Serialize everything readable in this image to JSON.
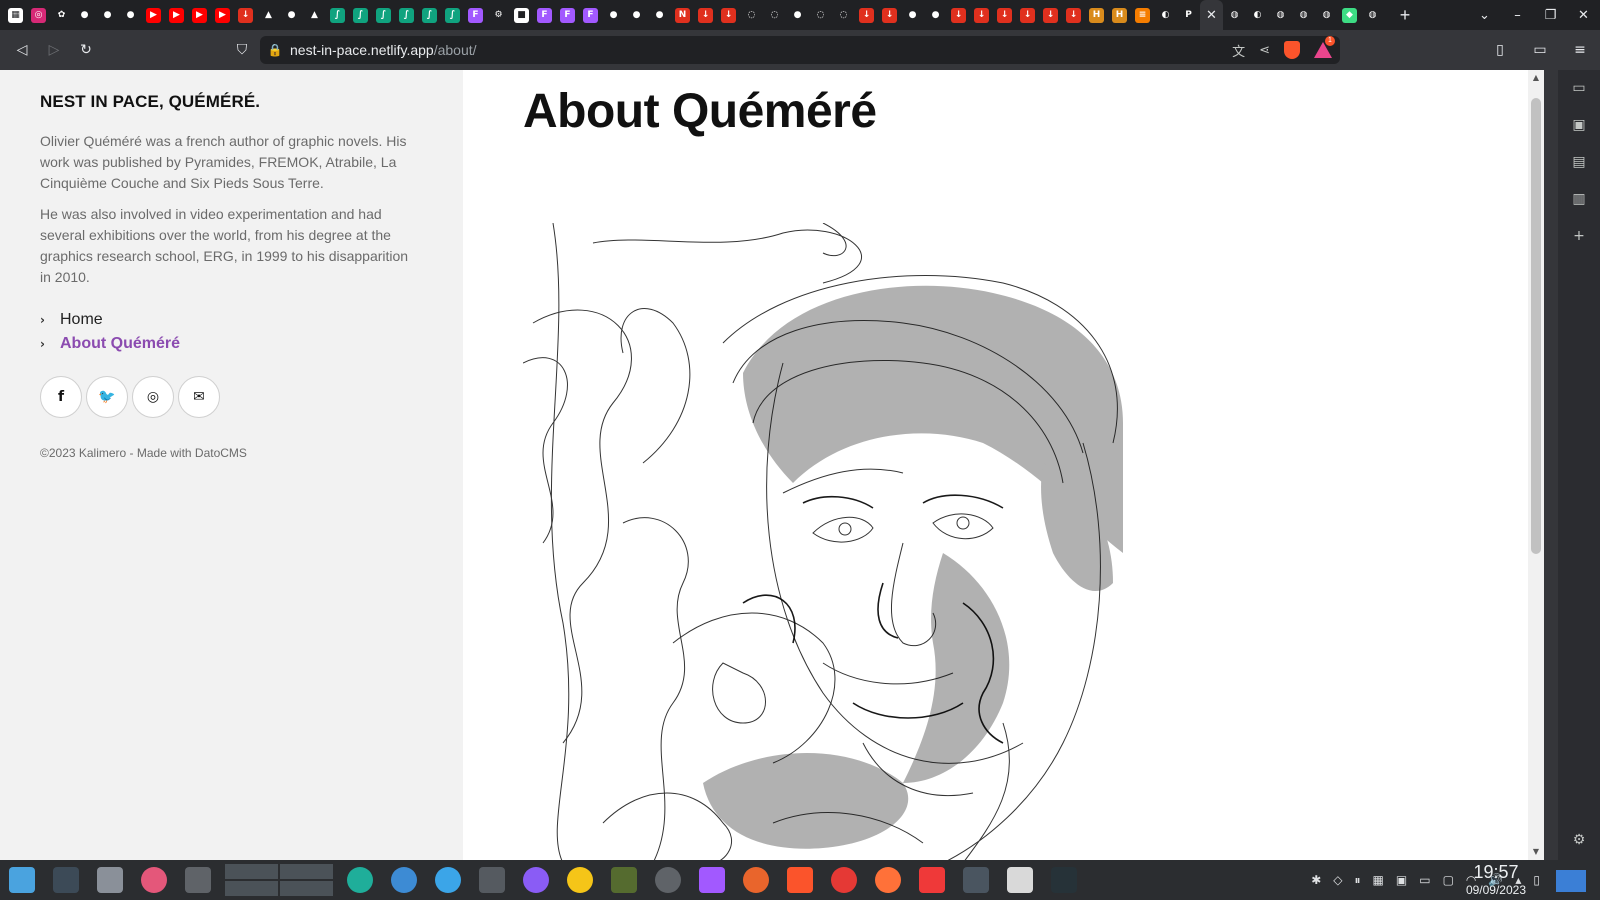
{
  "browser": {
    "tabs": [
      {
        "icon": "grid-icon",
        "color": "#ffffff",
        "glyph": "▦"
      },
      {
        "icon": "instagram-icon",
        "color": "#d62976",
        "glyph": "◎"
      },
      {
        "icon": "game-icon",
        "color": "#202124",
        "glyph": "✿"
      },
      {
        "icon": "github-icon",
        "color": "#202124",
        "glyph": "●"
      },
      {
        "icon": "github-icon",
        "color": "#202124",
        "glyph": "●"
      },
      {
        "icon": "github-icon",
        "color": "#202124",
        "glyph": "●"
      },
      {
        "icon": "youtube-icon",
        "color": "#ff0000",
        "glyph": "▶"
      },
      {
        "icon": "youtube-icon",
        "color": "#ff0000",
        "glyph": "▶"
      },
      {
        "icon": "youtube-icon",
        "color": "#ff0000",
        "glyph": "▶"
      },
      {
        "icon": "youtube-icon",
        "color": "#ff0000",
        "glyph": "▶"
      },
      {
        "icon": "download-icon",
        "color": "#e0301e",
        "glyph": "↓"
      },
      {
        "icon": "drive-icon",
        "color": "#202124",
        "glyph": "▲"
      },
      {
        "icon": "github-icon",
        "color": "#202124",
        "glyph": "●"
      },
      {
        "icon": "arc-icon",
        "color": "#202124",
        "glyph": "▲"
      },
      {
        "icon": "lean-icon",
        "color": "#10a37f",
        "glyph": "∫"
      },
      {
        "icon": "lean-icon",
        "color": "#10a37f",
        "glyph": "∫"
      },
      {
        "icon": "lean-icon",
        "color": "#10a37f",
        "glyph": "∫"
      },
      {
        "icon": "lean-icon",
        "color": "#10a37f",
        "glyph": "∫"
      },
      {
        "icon": "lean-icon",
        "color": "#10a37f",
        "glyph": "∫"
      },
      {
        "icon": "lean-icon",
        "color": "#10a37f",
        "glyph": "∫"
      },
      {
        "icon": "figma-icon",
        "color": "#a259ff",
        "glyph": "F"
      },
      {
        "icon": "settings-icon",
        "color": "#202124",
        "glyph": "⚙"
      },
      {
        "icon": "cube-icon",
        "color": "#ffffff",
        "glyph": "■"
      },
      {
        "icon": "figma-icon",
        "color": "#a259ff",
        "glyph": "F"
      },
      {
        "icon": "figma-icon",
        "color": "#a259ff",
        "glyph": "F"
      },
      {
        "icon": "figma-icon",
        "color": "#a259ff",
        "glyph": "F"
      },
      {
        "icon": "github-icon",
        "color": "#202124",
        "glyph": "●"
      },
      {
        "icon": "github-icon",
        "color": "#202124",
        "glyph": "●"
      },
      {
        "icon": "github-icon",
        "color": "#202124",
        "glyph": "●"
      },
      {
        "icon": "notion-icon",
        "color": "#e0301e",
        "glyph": "N"
      },
      {
        "icon": "download-icon",
        "color": "#e0301e",
        "glyph": "↓"
      },
      {
        "icon": "download-icon",
        "color": "#e0301e",
        "glyph": "↓"
      },
      {
        "icon": "ring-icon",
        "color": "#202124",
        "glyph": "◌"
      },
      {
        "icon": "ring-icon",
        "color": "#202124",
        "glyph": "◌"
      },
      {
        "icon": "github-icon",
        "color": "#202124",
        "glyph": "●"
      },
      {
        "icon": "ring-icon",
        "color": "#202124",
        "glyph": "◌"
      },
      {
        "icon": "ring-icon",
        "color": "#202124",
        "glyph": "◌"
      },
      {
        "icon": "download-icon",
        "color": "#e0301e",
        "glyph": "↓"
      },
      {
        "icon": "download-icon",
        "color": "#e0301e",
        "glyph": "↓"
      },
      {
        "icon": "github-icon",
        "color": "#202124",
        "glyph": "●"
      },
      {
        "icon": "github-icon",
        "color": "#202124",
        "glyph": "●"
      },
      {
        "icon": "download-icon",
        "color": "#e0301e",
        "glyph": "↓"
      },
      {
        "icon": "download-icon",
        "color": "#e0301e",
        "glyph": "↓"
      },
      {
        "icon": "download-icon",
        "color": "#e0301e",
        "glyph": "↓"
      },
      {
        "icon": "download-icon",
        "color": "#e0301e",
        "glyph": "↓"
      },
      {
        "icon": "download-icon",
        "color": "#e0301e",
        "glyph": "↓"
      },
      {
        "icon": "download-icon",
        "color": "#e0301e",
        "glyph": "↓"
      },
      {
        "icon": "hex-icon",
        "color": "#d98b1c",
        "glyph": "H"
      },
      {
        "icon": "hex-icon",
        "color": "#d98b1c",
        "glyph": "H"
      },
      {
        "icon": "blog-icon",
        "color": "#f57d00",
        "glyph": "≡"
      },
      {
        "icon": "globe-icon",
        "color": "#202124",
        "glyph": "◐"
      },
      {
        "icon": "patreon-icon",
        "color": "#202124",
        "glyph": "P"
      }
    ],
    "active_tab_close": "✕",
    "tabs_after": [
      {
        "icon": "globe-icon",
        "color": "#202124",
        "glyph": "◍"
      },
      {
        "icon": "globe-icon",
        "color": "#202124",
        "glyph": "◐"
      },
      {
        "icon": "globe-icon",
        "color": "#202124",
        "glyph": "◍"
      },
      {
        "icon": "globe-icon",
        "color": "#202124",
        "glyph": "◍"
      },
      {
        "icon": "globe-icon",
        "color": "#202124",
        "glyph": "◍"
      },
      {
        "icon": "android-icon",
        "color": "#3ddc84",
        "glyph": "◆"
      },
      {
        "icon": "globe-icon",
        "color": "#202124",
        "glyph": "◍"
      }
    ],
    "new_tab": "+",
    "window_controls": {
      "list": "⌄",
      "minimize": "–",
      "restore": "❐",
      "close": "✕"
    },
    "nav": {
      "back": "◁",
      "forward": "▷",
      "reload": "↻",
      "bookmark": "⛉"
    },
    "url": {
      "lock": "🔒",
      "host": "nest-in-pace.netlify.app",
      "path": "/about/"
    },
    "omni_icons": {
      "translate": "文",
      "share": "⋖"
    },
    "rewards_badge": "1",
    "toolbar_right": {
      "sidebar": "▯",
      "wallet": "▭",
      "menu": "≡"
    }
  },
  "sidebar": {
    "title": "NEST IN PACE, QUÉMÉRÉ.",
    "bio_1": "Olivier Quéméré was a french author of graphic novels. His work was published by Pyramides, FREMOK, Atrabile, La Cinquième Couche and Six Pieds Sous Terre.",
    "bio_2": "He was also involved in video experimentation and had several exhibitions over the world, from his degree at the graphics research school, ERG, in 1999 to his disapparition in 2010.",
    "nav": [
      {
        "label": "Home",
        "active": false
      },
      {
        "label": "About Quéméré",
        "active": true
      }
    ],
    "socials": [
      {
        "name": "facebook-icon",
        "glyph": "f"
      },
      {
        "name": "twitter-icon",
        "glyph": "🐦"
      },
      {
        "name": "instagram-icon",
        "glyph": "◎"
      },
      {
        "name": "email-icon",
        "glyph": "✉"
      }
    ],
    "footer": "©2023 Kalimero - Made with DatoCMS"
  },
  "main": {
    "heading": "About Quéméré",
    "accent_color": "#8b4bb0"
  },
  "side_panel": {
    "items": [
      "▭",
      "▣",
      "▤",
      "▥",
      "+"
    ],
    "gear": "⚙"
  },
  "taskbar": {
    "apps": [
      {
        "name": "app-launcher-icon",
        "color": "#4aa3df",
        "shape": "sq"
      },
      {
        "name": "terminal-icon",
        "color": "#3c4a57",
        "shape": "sq"
      },
      {
        "name": "files-icon",
        "color": "#8a9099",
        "shape": "sq"
      },
      {
        "name": "downloader-icon",
        "color": "#e4577a",
        "shape": "circle"
      },
      {
        "name": "stack-icon",
        "color": "#5f6368",
        "shape": "sq"
      }
    ],
    "apps_right": [
      {
        "name": "shutter-icon",
        "color": "#1fae9a",
        "shape": "circle"
      },
      {
        "name": "eye-icon",
        "color": "#3d8bd4",
        "shape": "circle"
      },
      {
        "name": "bird-icon",
        "color": "#3ba5e8",
        "shape": "circle"
      },
      {
        "name": "ship-icon",
        "color": "#555a60",
        "shape": "sq"
      },
      {
        "name": "obsidian-icon",
        "color": "#8a5cf5",
        "shape": "circle"
      },
      {
        "name": "color-picker-icon",
        "color": "#f5c518",
        "shape": "circle"
      },
      {
        "name": "tank-icon",
        "color": "#556b2f",
        "shape": "sq"
      },
      {
        "name": "settings-icon",
        "color": "#5f6368",
        "shape": "circle"
      },
      {
        "name": "figma-icon",
        "color": "#a259ff",
        "shape": "sq"
      },
      {
        "name": "firefox-dev-icon",
        "color": "#e9652c",
        "shape": "circle"
      },
      {
        "name": "brave-icon",
        "color": "#fb542b",
        "shape": "sq"
      },
      {
        "name": "opera-icon",
        "color": "#e53935",
        "shape": "circle"
      },
      {
        "name": "firefox-icon",
        "color": "#ff7139",
        "shape": "circle"
      },
      {
        "name": "vivaldi-icon",
        "color": "#ef3939",
        "shape": "sq"
      },
      {
        "name": "task-icon",
        "color": "#4a5560",
        "shape": "sq"
      },
      {
        "name": "clipboard-icon",
        "color": "#d9d9d9",
        "shape": "sq"
      },
      {
        "name": "display-icon",
        "color": "#263238",
        "shape": "sq"
      }
    ],
    "tray": [
      "✱",
      "◇",
      "⏸",
      "▦",
      "▣",
      "▭",
      "▢",
      "◠",
      "🔊",
      "▴",
      "▯"
    ],
    "time": "19:57",
    "date": "09/09/2023"
  }
}
